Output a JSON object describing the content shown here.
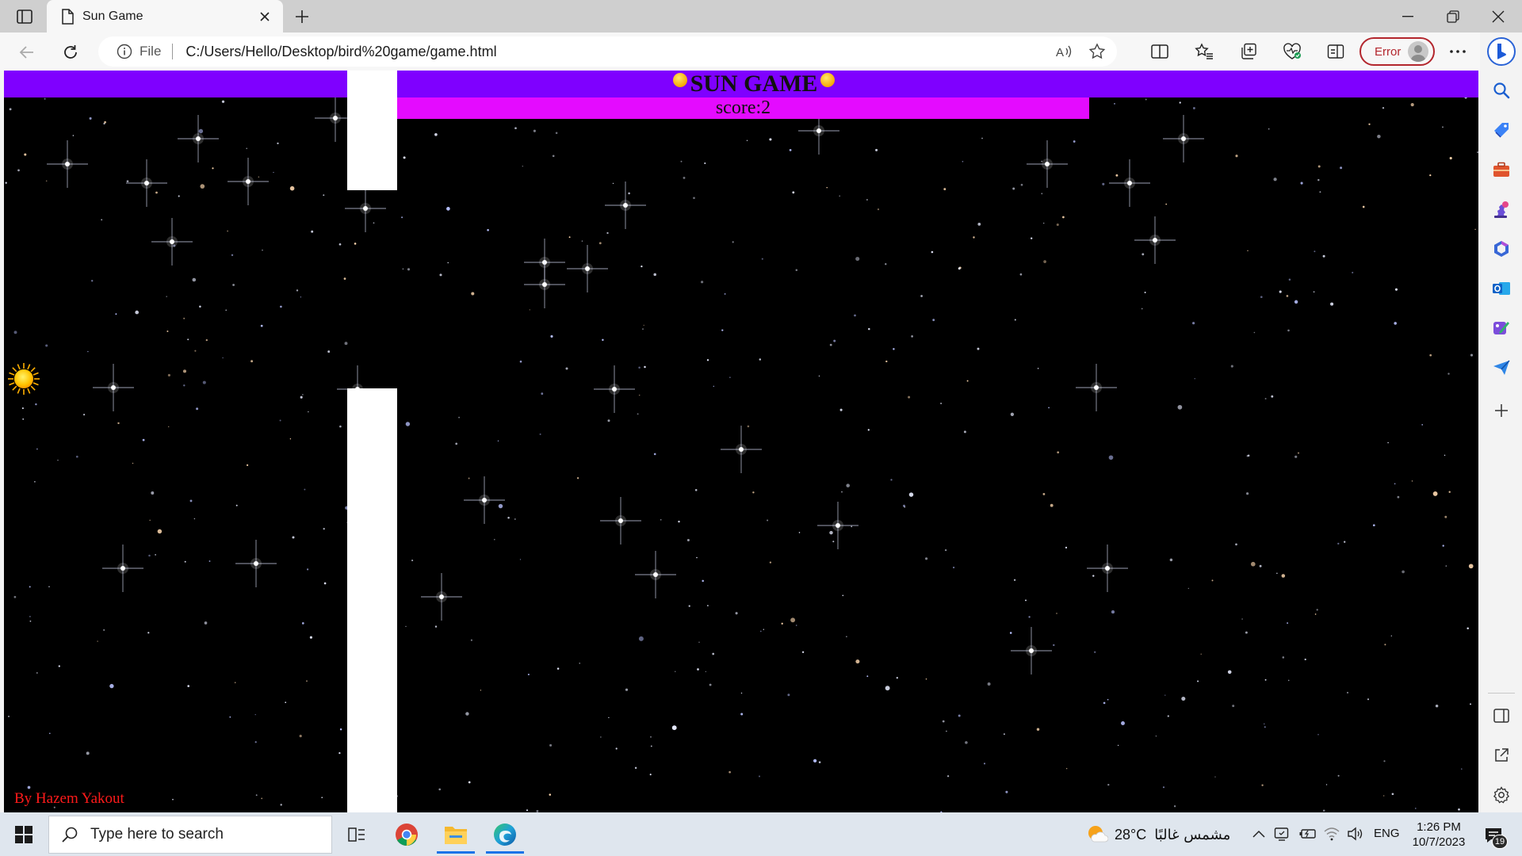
{
  "browser": {
    "tab": {
      "title": "Sun Game",
      "icon": "document-icon"
    },
    "address": {
      "scheme_label": "File",
      "url": "C:/Users/Hello/Desktop/bird%20game/game.html"
    },
    "profile": {
      "label": "Error"
    },
    "colors": {
      "profile_error": "#b3262d",
      "tabbar": "#cfcfcf",
      "toolbar": "#f7f7f7"
    }
  },
  "game": {
    "title": "SUN GAME",
    "score_text": "score:2",
    "byline": "By Hazem Yakout",
    "colors": {
      "header": "#7f00ff",
      "score_bar": "#e40bff",
      "byline": "#ff1a1a",
      "pipe": "#ffffff",
      "background": "#000000"
    }
  },
  "taskbar": {
    "search_placeholder": "Type here to search",
    "weather": {
      "temp": "28°C",
      "condition": "مشمس غالبًا"
    },
    "language": "ENG",
    "time": "1:26 PM",
    "date": "10/7/2023",
    "notification_count": "19"
  }
}
